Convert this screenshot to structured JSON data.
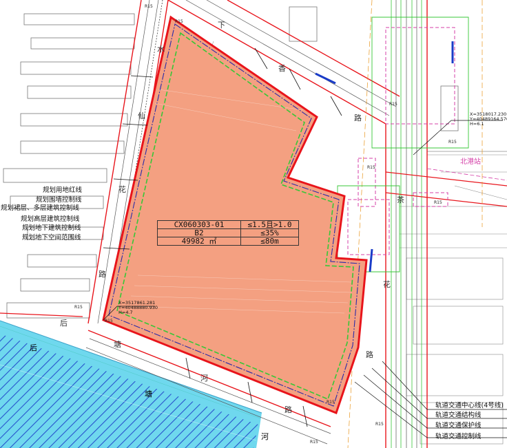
{
  "parcel": {
    "code": "CX060303-01",
    "far": "≤1.5且>1.0",
    "land_use": "B2",
    "density": "≤35%",
    "area": "49982 ㎡",
    "height": "≤80m"
  },
  "roads": {
    "left_vertical": [
      "水",
      "仙",
      "花",
      "路"
    ],
    "top_diagonal": [
      "下",
      "香",
      "路"
    ],
    "right_vertical": [
      "茶",
      "花",
      "路"
    ],
    "bottom_road": [
      "后",
      "塘",
      "河",
      "路"
    ],
    "river": [
      "后",
      "塘",
      "河"
    ]
  },
  "legend_left": [
    "规划用地红线",
    "规划围墙控制线",
    "规划裙层、多层建筑控制线",
    "规划高层建筑控制线",
    "规划地下建筑控制线",
    "规划地下空间范围线"
  ],
  "legend_rail": [
    "轨道交通中心线(4号线)",
    "轨道交通结构线",
    "轨道交通保护线",
    "轨道交通控制线"
  ],
  "station": "北港站",
  "coords": {
    "sw": "X=3517861.281\nY=40488880.930\nH=4.7",
    "ne": "X=3518017.230\nY=40489164.576\nH=6.1"
  },
  "radius_labels": [
    "R15",
    "R15",
    "R15",
    "R15",
    "R15",
    "R15",
    "R15",
    "R15",
    "R15",
    "R15",
    "R15"
  ],
  "colors": {
    "parcel_fill": "#f4a081",
    "red_line": "#e8141b",
    "green_line": "#37c737",
    "blue_line": "#2a2aa8",
    "magenta_line": "#d43fa7",
    "river_fill": "#6fd8ee",
    "hatch": "#1a3cc8"
  }
}
